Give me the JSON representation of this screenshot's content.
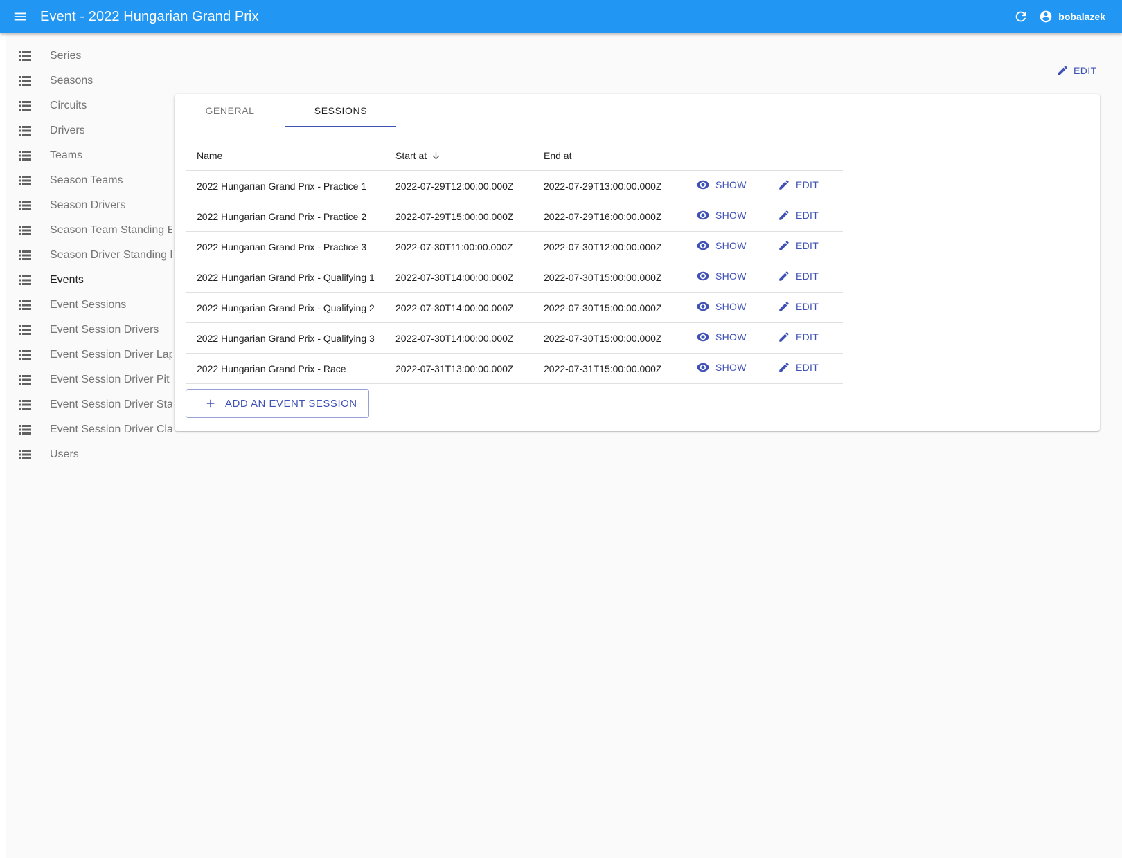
{
  "appbar": {
    "title": "Event - 2022 Hungarian Grand Prix",
    "username": "bobalazek",
    "color": "#2196f3"
  },
  "sidebar": {
    "items": [
      {
        "label": "Series"
      },
      {
        "label": "Seasons"
      },
      {
        "label": "Circuits"
      },
      {
        "label": "Drivers"
      },
      {
        "label": "Teams"
      },
      {
        "label": "Season Teams"
      },
      {
        "label": "Season Drivers"
      },
      {
        "label": "Season Team Standing E"
      },
      {
        "label": "Season Driver Standing E"
      },
      {
        "label": "Events",
        "active": true
      },
      {
        "label": "Event Sessions"
      },
      {
        "label": "Event Session Drivers"
      },
      {
        "label": "Event Session Driver Lap"
      },
      {
        "label": "Event Session Driver Pit S"
      },
      {
        "label": "Event Session Driver Star"
      },
      {
        "label": "Event Session Driver Clas"
      },
      {
        "label": "Users"
      }
    ]
  },
  "toolbar": {
    "edit_label": "EDIT"
  },
  "tabs": [
    {
      "label": "GENERAL",
      "active": false
    },
    {
      "label": "SESSIONS",
      "active": true
    }
  ],
  "table": {
    "headers": {
      "name": "Name",
      "start": "Start at",
      "end": "End at"
    },
    "show_label": "SHOW",
    "edit_label": "EDIT",
    "rows": [
      {
        "name": "2022 Hungarian Grand Prix - Practice 1",
        "start": "2022-07-29T12:00:00.000Z",
        "end": "2022-07-29T13:00:00.000Z"
      },
      {
        "name": "2022 Hungarian Grand Prix - Practice 2",
        "start": "2022-07-29T15:00:00.000Z",
        "end": "2022-07-29T16:00:00.000Z"
      },
      {
        "name": "2022 Hungarian Grand Prix - Practice 3",
        "start": "2022-07-30T11:00:00.000Z",
        "end": "2022-07-30T12:00:00.000Z"
      },
      {
        "name": "2022 Hungarian Grand Prix - Qualifying 1",
        "start": "2022-07-30T14:00:00.000Z",
        "end": "2022-07-30T15:00:00.000Z"
      },
      {
        "name": "2022 Hungarian Grand Prix - Qualifying 2",
        "start": "2022-07-30T14:00:00.000Z",
        "end": "2022-07-30T15:00:00.000Z"
      },
      {
        "name": "2022 Hungarian Grand Prix - Qualifying 3",
        "start": "2022-07-30T14:00:00.000Z",
        "end": "2022-07-30T15:00:00.000Z"
      },
      {
        "name": "2022 Hungarian Grand Prix - Race",
        "start": "2022-07-31T13:00:00.000Z",
        "end": "2022-07-31T15:00:00.000Z"
      }
    ]
  },
  "add_button": {
    "label": "ADD AN EVENT SESSION"
  },
  "accent_color": "#3f51b5"
}
